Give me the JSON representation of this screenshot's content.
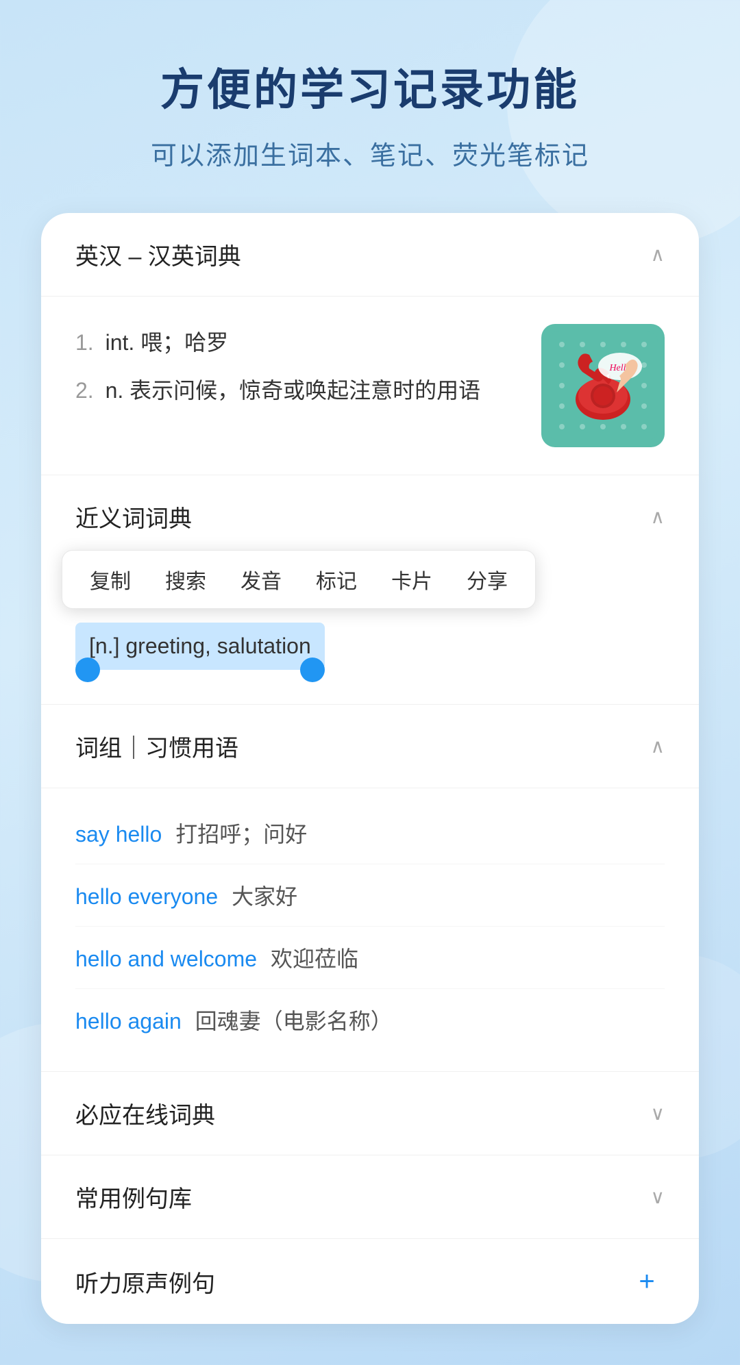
{
  "header": {
    "title": "方便的学习记录功能",
    "subtitle": "可以添加生词本、笔记、荧光笔标记"
  },
  "dict_section": {
    "title": "英汉 – 汉英词典",
    "definitions": [
      {
        "number": "1.",
        "text": "int. 喂；哈罗"
      },
      {
        "number": "2.",
        "text": "n. 表示问候，惊奇或唤起注意时的用语"
      }
    ]
  },
  "synonym_section": {
    "title": "近义词词典",
    "context_menu_items": [
      "复制",
      "搜索",
      "发音",
      "标记",
      "卡片",
      "分享"
    ],
    "highlighted": "[n.] greeting, salutation"
  },
  "phrases_section": {
    "title": "词组｜习惯用语",
    "phrases": [
      {
        "english": "say hello",
        "chinese": "打招呼；问好"
      },
      {
        "english": "hello everyone",
        "chinese": "大家好"
      },
      {
        "english": "hello and welcome",
        "chinese": "欢迎莅临"
      },
      {
        "english": "hello again",
        "chinese": "回魂妻（电影名称）"
      }
    ]
  },
  "collapsed_sections": [
    {
      "title": "必应在线词典"
    },
    {
      "title": "常用例句库"
    }
  ],
  "last_section": {
    "title": "听力原声例句",
    "plus_label": "+"
  },
  "icons": {
    "chevron_up": "∧",
    "chevron_down": "∨",
    "plus": "+"
  }
}
